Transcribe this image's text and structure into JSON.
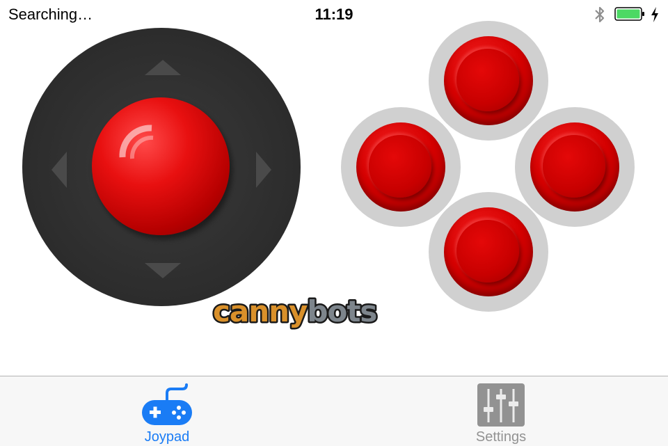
{
  "status_bar": {
    "carrier_text": "Searching…",
    "time": "11:19",
    "icons": [
      "bluetooth-icon",
      "battery-icon",
      "charging-icon"
    ]
  },
  "controls": {
    "joystick": {
      "arrows": [
        "up",
        "down",
        "left",
        "right"
      ]
    },
    "buttons": [
      "top",
      "left",
      "right",
      "bottom"
    ]
  },
  "logo": {
    "part1": "canny",
    "part2": "bots",
    "part1_color": "#d9902a",
    "part2_color": "#7d858c"
  },
  "tabs": [
    {
      "label": "Joypad",
      "icon": "gamepad-icon",
      "selected": true
    },
    {
      "label": "Settings",
      "icon": "sliders-icon",
      "selected": false
    }
  ],
  "colors": {
    "accent": "#1a7cf5",
    "button_red": "#d40000",
    "joystick_base": "#2f2f2f"
  }
}
